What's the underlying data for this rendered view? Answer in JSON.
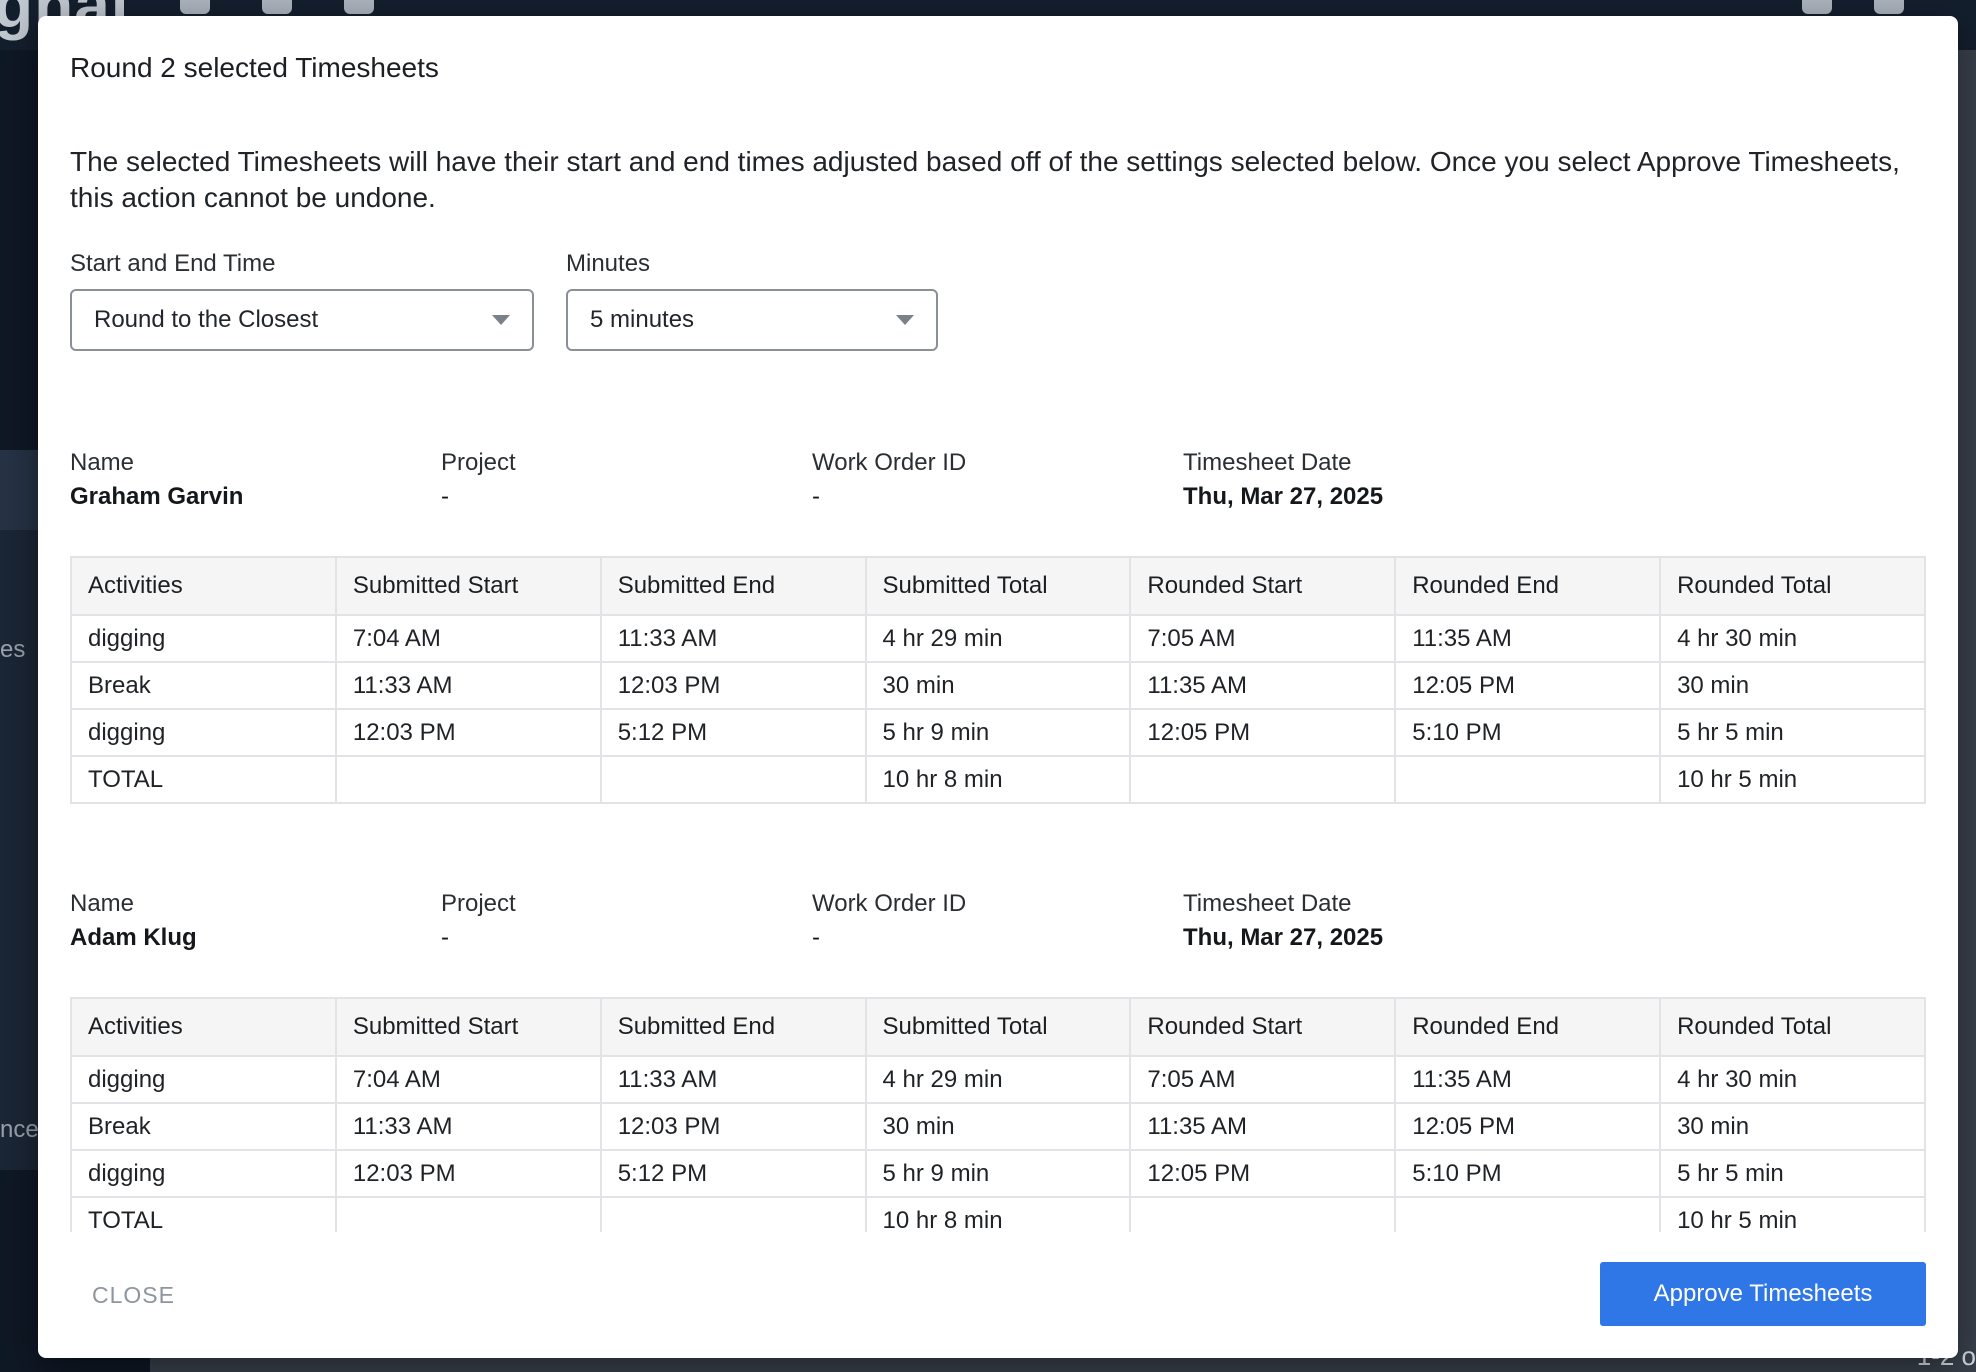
{
  "background": {
    "logo_fragment": "gnal",
    "sidebar_fragment_1": "es",
    "sidebar_fragment_2": "nce",
    "bottom_right_fragment": "1-2 o"
  },
  "modal": {
    "title": "Round 2 selected Timesheets",
    "description": "The selected Timesheets will have their start and end times adjusted based off of the settings selected below. Once you select Approve Timesheets, this action cannot be undone.",
    "start_end_label": "Start and End Time",
    "start_end_value": "Round to the Closest",
    "minutes_label": "Minutes",
    "minutes_value": "5 minutes",
    "close_label": "CLOSE",
    "approve_label": "Approve Timesheets"
  },
  "meta_labels": {
    "name": "Name",
    "project": "Project",
    "work_order": "Work Order ID",
    "date": "Timesheet Date"
  },
  "columns": [
    "Activities",
    "Submitted Start",
    "Submitted End",
    "Submitted Total",
    "Rounded Start",
    "Rounded End",
    "Rounded Total"
  ],
  "timesheets": [
    {
      "name": "Graham Garvin",
      "project": "-",
      "work_order": "-",
      "date": "Thu, Mar 27, 2025",
      "rows": [
        [
          "digging",
          "7:04 AM",
          "11:33 AM",
          "4 hr 29 min",
          "7:05 AM",
          "11:35 AM",
          "4 hr 30 min"
        ],
        [
          "Break",
          "11:33 AM",
          "12:03 PM",
          "30 min",
          "11:35 AM",
          "12:05 PM",
          "30 min"
        ],
        [
          "digging",
          "12:03 PM",
          "5:12 PM",
          "5 hr 9 min",
          "12:05 PM",
          "5:10 PM",
          "5 hr 5 min"
        ],
        [
          "TOTAL",
          "",
          "",
          "10 hr 8 min",
          "",
          "",
          "10 hr 5 min"
        ]
      ]
    },
    {
      "name": "Adam Klug",
      "project": "-",
      "work_order": "-",
      "date": "Thu, Mar 27, 2025",
      "rows": [
        [
          "digging",
          "7:04 AM",
          "11:33 AM",
          "4 hr 29 min",
          "7:05 AM",
          "11:35 AM",
          "4 hr 30 min"
        ],
        [
          "Break",
          "11:33 AM",
          "12:03 PM",
          "30 min",
          "11:35 AM",
          "12:05 PM",
          "30 min"
        ],
        [
          "digging",
          "12:03 PM",
          "5:12 PM",
          "5 hr 9 min",
          "12:05 PM",
          "5:10 PM",
          "5 hr 5 min"
        ],
        [
          "TOTAL",
          "",
          "",
          "10 hr 8 min",
          "",
          "",
          "10 hr 5 min"
        ]
      ]
    }
  ]
}
